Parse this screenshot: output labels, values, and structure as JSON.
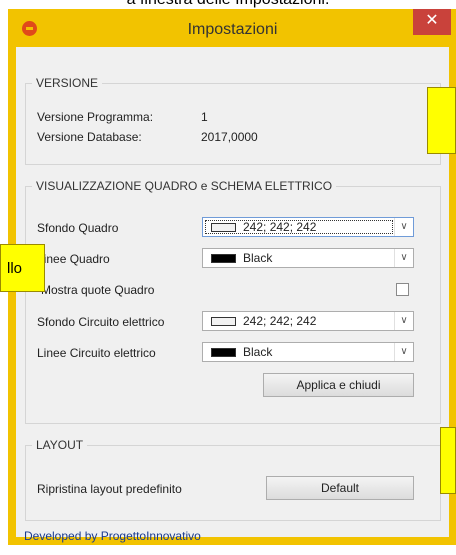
{
  "caption": "a finestra delle Impostazioni.",
  "window": {
    "title": "Impostazioni",
    "close_glyph": "✕"
  },
  "versione": {
    "title": "VERSIONE",
    "program_label": "Versione Programma:",
    "program_value": "1",
    "db_label": "Versione Database:",
    "db_value": "2017,0000"
  },
  "visualizzazione": {
    "title": "VISUALIZZAZIONE QUADRO e SCHEMA ELETTRICO",
    "sfondo_quadro": {
      "label": "Sfondo Quadro",
      "value": "242; 242; 242",
      "swatch": "#f2f2f2"
    },
    "linee_quadro": {
      "label": "Linee Quadro",
      "value": "Black",
      "swatch": "#000000"
    },
    "mostra_quote": {
      "label": "Mostra quote Quadro",
      "checked": false
    },
    "sfondo_circuito": {
      "label": "Sfondo Circuito elettrico",
      "value": "242; 242; 242",
      "swatch": "#f2f2f2"
    },
    "linee_circuito": {
      "label": "Linee Circuito elettrico",
      "value": "Black",
      "swatch": "#000000"
    },
    "apply_label": "Applica e chiudi"
  },
  "layout": {
    "title": "LAYOUT",
    "reset_label": "Ripristina layout predefinito",
    "default_label": "Default"
  },
  "footer": {
    "link": "Developed by ProgettoInnovativo"
  },
  "callout_left": {
    "text": "llo"
  },
  "colors": {
    "window_frame": "#f2c300",
    "close": "#c9423b",
    "callout": "#ffff00"
  }
}
